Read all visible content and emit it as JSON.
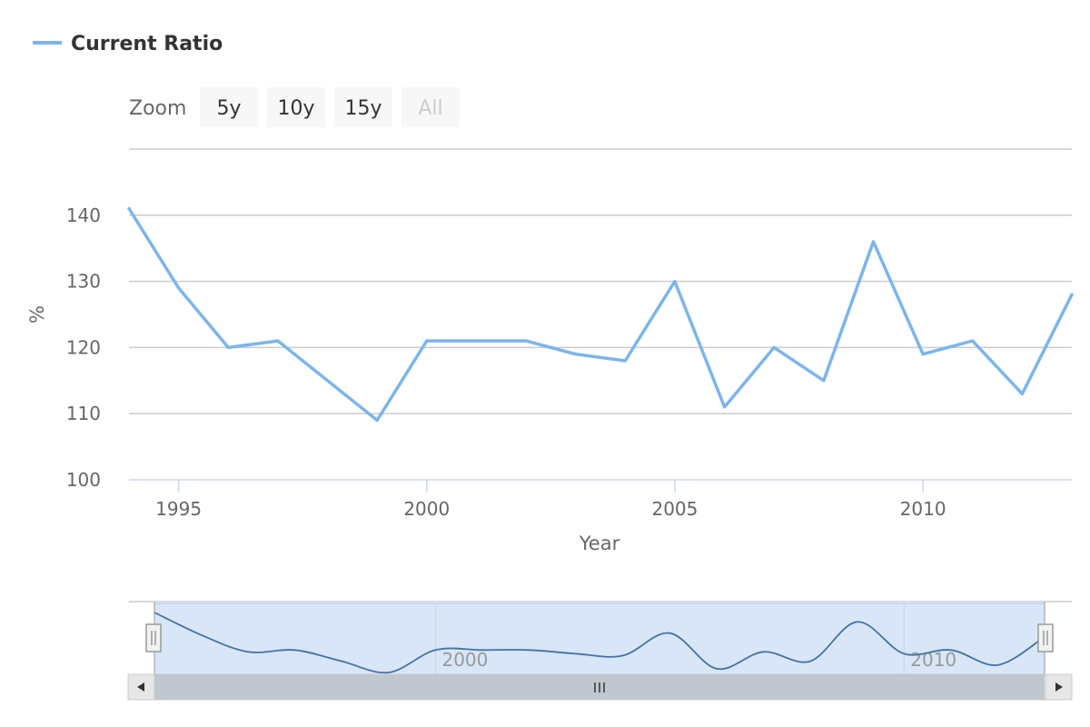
{
  "legend": {
    "label": "Current Ratio",
    "color": "#7cb5ec"
  },
  "zoom": {
    "label": "Zoom",
    "buttons": [
      {
        "label": "5y",
        "disabled": false
      },
      {
        "label": "10y",
        "disabled": false
      },
      {
        "label": "15y",
        "disabled": false
      },
      {
        "label": "All",
        "disabled": true
      }
    ]
  },
  "chart_data": {
    "type": "line",
    "title": "",
    "xlabel": "Year",
    "ylabel": "%",
    "x": [
      1994,
      1995,
      1996,
      1997,
      1998,
      1999,
      2000,
      2001,
      2002,
      2003,
      2004,
      2005,
      2006,
      2007,
      2008,
      2009,
      2010,
      2011,
      2012,
      2013
    ],
    "series": [
      {
        "name": "Current Ratio",
        "values": [
          141,
          129,
          120,
          121,
          115,
          109,
          121,
          121,
          121,
          119,
          118,
          130,
          111,
          120,
          115,
          136,
          119,
          121,
          113,
          128
        ]
      }
    ],
    "xlim": [
      1994,
      2013
    ],
    "ylim": [
      100,
      150
    ],
    "x_ticks": [
      1995,
      2000,
      2005,
      2010
    ],
    "y_ticks": [
      100,
      110,
      120,
      130,
      140
    ],
    "grid": true,
    "legend_position": "top-left",
    "navigator": {
      "range": [
        1994,
        2013
      ],
      "ticks": [
        2000,
        2010
      ]
    }
  },
  "colors": {
    "series": "#7cb5ec",
    "navigator_series": "#4572a7",
    "grid": "#cccccc",
    "axis": "#ccd6eb",
    "navigator_mask": "#d8e6f7",
    "scrollbar": "#c1c7d0",
    "button_bg": "#f7f7f7"
  }
}
